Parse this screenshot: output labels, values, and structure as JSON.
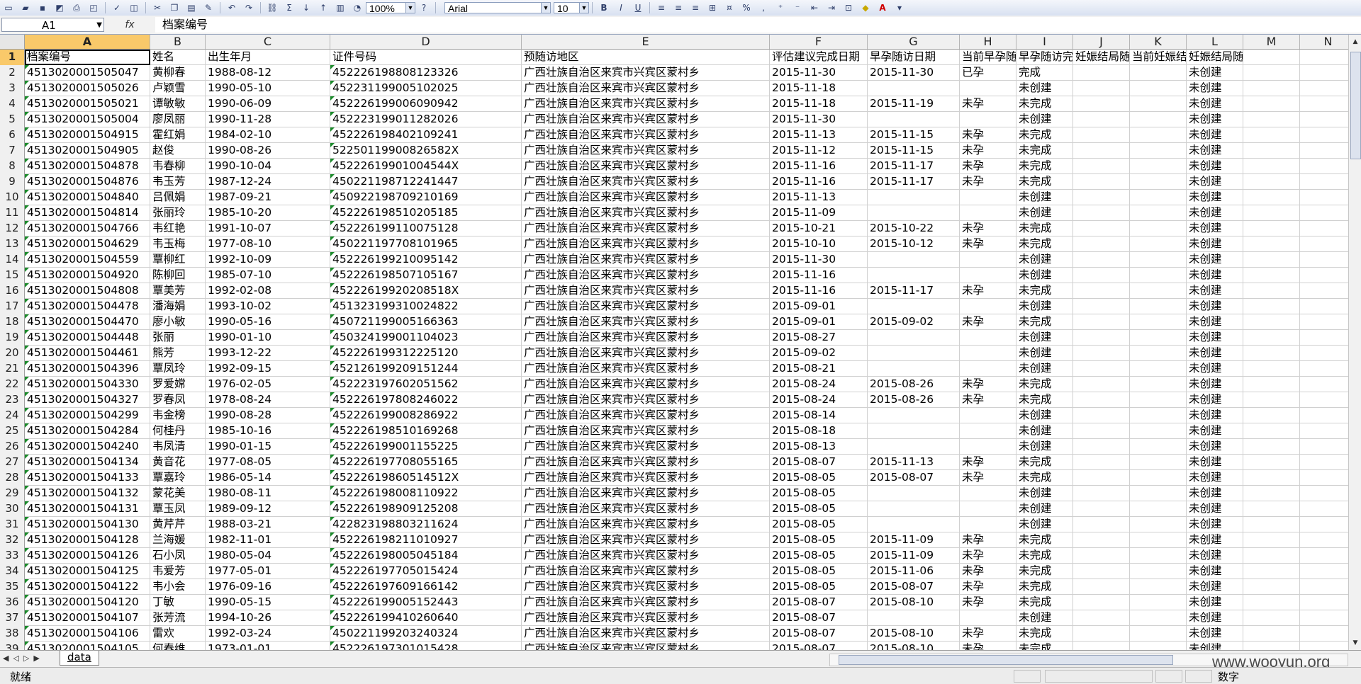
{
  "toolbar": {
    "zoom": "100%",
    "font_name": "Arial",
    "font_size": "10",
    "bold": "B",
    "italic": "I",
    "underline": "U",
    "percent": "%",
    "comma": ",",
    "sigma": "Σ"
  },
  "formula_bar": {
    "cell_ref": "A1",
    "fx": "fx",
    "content": "档案编号"
  },
  "columns": [
    "A",
    "B",
    "C",
    "D",
    "E",
    "F",
    "G",
    "H",
    "I",
    "J",
    "K",
    "L",
    "M",
    "N"
  ],
  "header_row": [
    "档案编号",
    "姓名",
    "出生年月",
    "证件号码",
    "预随访地区",
    "评估建议完成日期",
    "早孕随访日期",
    "当前早孕随访",
    "早孕随访完成",
    "妊娠结局随访日期",
    "当前妊娠结局",
    "妊娠结局随访完成状态",
    "",
    ""
  ],
  "rows": [
    {
      "n": "2",
      "cells": [
        "4513020001505047",
        "黄柳春",
        "1988-08-12",
        "452226198808123326",
        "广西壮族自治区来宾市兴宾区蒙村乡",
        "2015-11-30",
        "2015-11-30",
        "已孕",
        "完成",
        "",
        "",
        "未创建",
        "",
        ""
      ]
    },
    {
      "n": "3",
      "cells": [
        "4513020001505026",
        "卢颖雪",
        "1990-05-10",
        "452231199005102025",
        "广西壮族自治区来宾市兴宾区蒙村乡",
        "2015-11-18",
        "",
        "",
        "未创建",
        "",
        "",
        "未创建",
        "",
        ""
      ]
    },
    {
      "n": "4",
      "cells": [
        "4513020001505021",
        "谭敏敏",
        "1990-06-09",
        "452226199006090942",
        "广西壮族自治区来宾市兴宾区蒙村乡",
        "2015-11-18",
        "2015-11-19",
        "未孕",
        "未完成",
        "",
        "",
        "未创建",
        "",
        ""
      ]
    },
    {
      "n": "5",
      "cells": [
        "4513020001505004",
        "廖凤丽",
        "1990-11-28",
        "452223199011282026",
        "广西壮族自治区来宾市兴宾区蒙村乡",
        "2015-11-30",
        "",
        "",
        "未创建",
        "",
        "",
        "未创建",
        "",
        ""
      ]
    },
    {
      "n": "6",
      "cells": [
        "4513020001504915",
        "霍红娟",
        "1984-02-10",
        "452226198402109241",
        "广西壮族自治区来宾市兴宾区蒙村乡",
        "2015-11-13",
        "2015-11-15",
        "未孕",
        "未完成",
        "",
        "",
        "未创建",
        "",
        ""
      ]
    },
    {
      "n": "7",
      "cells": [
        "4513020001504905",
        "赵俊",
        "1990-08-26",
        "52250119900826582X",
        "广西壮族自治区来宾市兴宾区蒙村乡",
        "2015-11-12",
        "2015-11-15",
        "未孕",
        "未完成",
        "",
        "",
        "未创建",
        "",
        ""
      ]
    },
    {
      "n": "8",
      "cells": [
        "4513020001504878",
        "韦春柳",
        "1990-10-04",
        "45222619901004544X",
        "广西壮族自治区来宾市兴宾区蒙村乡",
        "2015-11-16",
        "2015-11-17",
        "未孕",
        "未完成",
        "",
        "",
        "未创建",
        "",
        ""
      ]
    },
    {
      "n": "9",
      "cells": [
        "4513020001504876",
        "韦玉芳",
        "1987-12-24",
        "450221198712241447",
        "广西壮族自治区来宾市兴宾区蒙村乡",
        "2015-11-16",
        "2015-11-17",
        "未孕",
        "未完成",
        "",
        "",
        "未创建",
        "",
        ""
      ]
    },
    {
      "n": "10",
      "cells": [
        "4513020001504840",
        "吕佩娟",
        "1987-09-21",
        "450922198709210169",
        "广西壮族自治区来宾市兴宾区蒙村乡",
        "2015-11-13",
        "",
        "",
        "未创建",
        "",
        "",
        "未创建",
        "",
        ""
      ]
    },
    {
      "n": "11",
      "cells": [
        "4513020001504814",
        "张丽玲",
        "1985-10-20",
        "452226198510205185",
        "广西壮族自治区来宾市兴宾区蒙村乡",
        "2015-11-09",
        "",
        "",
        "未创建",
        "",
        "",
        "未创建",
        "",
        ""
      ]
    },
    {
      "n": "12",
      "cells": [
        "4513020001504766",
        "韦红艳",
        "1991-10-07",
        "452226199110075128",
        "广西壮族自治区来宾市兴宾区蒙村乡",
        "2015-10-21",
        "2015-10-22",
        "未孕",
        "未完成",
        "",
        "",
        "未创建",
        "",
        ""
      ]
    },
    {
      "n": "13",
      "cells": [
        "4513020001504629",
        "韦玉梅",
        "1977-08-10",
        "450221197708101965",
        "广西壮族自治区来宾市兴宾区蒙村乡",
        "2015-10-10",
        "2015-10-12",
        "未孕",
        "未完成",
        "",
        "",
        "未创建",
        "",
        ""
      ]
    },
    {
      "n": "14",
      "cells": [
        "4513020001504559",
        "覃柳红",
        "1992-10-09",
        "452226199210095142",
        "广西壮族自治区来宾市兴宾区蒙村乡",
        "2015-11-30",
        "",
        "",
        "未创建",
        "",
        "",
        "未创建",
        "",
        ""
      ]
    },
    {
      "n": "15",
      "cells": [
        "4513020001504920",
        "陈柳回",
        "1985-07-10",
        "452226198507105167",
        "广西壮族自治区来宾市兴宾区蒙村乡",
        "2015-11-16",
        "",
        "",
        "未创建",
        "",
        "",
        "未创建",
        "",
        ""
      ]
    },
    {
      "n": "16",
      "cells": [
        "4513020001504808",
        "覃美芳",
        "1992-02-08",
        "45222619920208518X",
        "广西壮族自治区来宾市兴宾区蒙村乡",
        "2015-11-16",
        "2015-11-17",
        "未孕",
        "未完成",
        "",
        "",
        "未创建",
        "",
        ""
      ]
    },
    {
      "n": "17",
      "cells": [
        "4513020001504478",
        "潘海娟",
        "1993-10-02",
        "451323199310024822",
        "广西壮族自治区来宾市兴宾区蒙村乡",
        "2015-09-01",
        "",
        "",
        "未创建",
        "",
        "",
        "未创建",
        "",
        ""
      ]
    },
    {
      "n": "18",
      "cells": [
        "4513020001504470",
        "廖小敏",
        "1990-05-16",
        "450721199005166363",
        "广西壮族自治区来宾市兴宾区蒙村乡",
        "2015-09-01",
        "2015-09-02",
        "未孕",
        "未完成",
        "",
        "",
        "未创建",
        "",
        ""
      ]
    },
    {
      "n": "19",
      "cells": [
        "4513020001504448",
        "张丽",
        "1990-01-10",
        "450324199001104023",
        "广西壮族自治区来宾市兴宾区蒙村乡",
        "2015-08-27",
        "",
        "",
        "未创建",
        "",
        "",
        "未创建",
        "",
        ""
      ]
    },
    {
      "n": "20",
      "cells": [
        "4513020001504461",
        "熊芳",
        "1993-12-22",
        "452226199312225120",
        "广西壮族自治区来宾市兴宾区蒙村乡",
        "2015-09-02",
        "",
        "",
        "未创建",
        "",
        "",
        "未创建",
        "",
        ""
      ]
    },
    {
      "n": "21",
      "cells": [
        "4513020001504396",
        "覃凤玲",
        "1992-09-15",
        "452126199209151244",
        "广西壮族自治区来宾市兴宾区蒙村乡",
        "2015-08-21",
        "",
        "",
        "未创建",
        "",
        "",
        "未创建",
        "",
        ""
      ]
    },
    {
      "n": "22",
      "cells": [
        "4513020001504330",
        "罗爱嫦",
        "1976-02-05",
        "452223197602051562",
        "广西壮族自治区来宾市兴宾区蒙村乡",
        "2015-08-24",
        "2015-08-26",
        "未孕",
        "未完成",
        "",
        "",
        "未创建",
        "",
        ""
      ]
    },
    {
      "n": "23",
      "cells": [
        "4513020001504327",
        "罗春凤",
        "1978-08-24",
        "452226197808246022",
        "广西壮族自治区来宾市兴宾区蒙村乡",
        "2015-08-24",
        "2015-08-26",
        "未孕",
        "未完成",
        "",
        "",
        "未创建",
        "",
        ""
      ]
    },
    {
      "n": "24",
      "cells": [
        "4513020001504299",
        "韦金榜",
        "1990-08-28",
        "452226199008286922",
        "广西壮族自治区来宾市兴宾区蒙村乡",
        "2015-08-14",
        "",
        "",
        "未创建",
        "",
        "",
        "未创建",
        "",
        ""
      ]
    },
    {
      "n": "25",
      "cells": [
        "4513020001504284",
        "何桂丹",
        "1985-10-16",
        "452226198510169268",
        "广西壮族自治区来宾市兴宾区蒙村乡",
        "2015-08-18",
        "",
        "",
        "未创建",
        "",
        "",
        "未创建",
        "",
        ""
      ]
    },
    {
      "n": "26",
      "cells": [
        "4513020001504240",
        "韦凤清",
        "1990-01-15",
        "452226199001155225",
        "广西壮族自治区来宾市兴宾区蒙村乡",
        "2015-08-13",
        "",
        "",
        "未创建",
        "",
        "",
        "未创建",
        "",
        ""
      ]
    },
    {
      "n": "27",
      "cells": [
        "4513020001504134",
        "黄音花",
        "1977-08-05",
        "452226197708055165",
        "广西壮族自治区来宾市兴宾区蒙村乡",
        "2015-08-07",
        "2015-11-13",
        "未孕",
        "未完成",
        "",
        "",
        "未创建",
        "",
        ""
      ]
    },
    {
      "n": "28",
      "cells": [
        "4513020001504133",
        "覃嘉玲",
        "1986-05-14",
        "45222619860514512X",
        "广西壮族自治区来宾市兴宾区蒙村乡",
        "2015-08-05",
        "2015-08-07",
        "未孕",
        "未完成",
        "",
        "",
        "未创建",
        "",
        ""
      ]
    },
    {
      "n": "29",
      "cells": [
        "4513020001504132",
        "蒙花美",
        "1980-08-11",
        "452226198008110922",
        "广西壮族自治区来宾市兴宾区蒙村乡",
        "2015-08-05",
        "",
        "",
        "未创建",
        "",
        "",
        "未创建",
        "",
        ""
      ]
    },
    {
      "n": "30",
      "cells": [
        "4513020001504131",
        "覃玉凤",
        "1989-09-12",
        "452226198909125208",
        "广西壮族自治区来宾市兴宾区蒙村乡",
        "2015-08-05",
        "",
        "",
        "未创建",
        "",
        "",
        "未创建",
        "",
        ""
      ]
    },
    {
      "n": "31",
      "cells": [
        "4513020001504130",
        "黄芹芹",
        "1988-03-21",
        "422823198803211624",
        "广西壮族自治区来宾市兴宾区蒙村乡",
        "2015-08-05",
        "",
        "",
        "未创建",
        "",
        "",
        "未创建",
        "",
        ""
      ]
    },
    {
      "n": "32",
      "cells": [
        "4513020001504128",
        "兰海媛",
        "1982-11-01",
        "452226198211010927",
        "广西壮族自治区来宾市兴宾区蒙村乡",
        "2015-08-05",
        "2015-11-09",
        "未孕",
        "未完成",
        "",
        "",
        "未创建",
        "",
        ""
      ]
    },
    {
      "n": "33",
      "cells": [
        "4513020001504126",
        "石小凤",
        "1980-05-04",
        "452226198005045184",
        "广西壮族自治区来宾市兴宾区蒙村乡",
        "2015-08-05",
        "2015-11-09",
        "未孕",
        "未完成",
        "",
        "",
        "未创建",
        "",
        ""
      ]
    },
    {
      "n": "34",
      "cells": [
        "4513020001504125",
        "韦爱芳",
        "1977-05-01",
        "452226197705015424",
        "广西壮族自治区来宾市兴宾区蒙村乡",
        "2015-08-05",
        "2015-11-06",
        "未孕",
        "未完成",
        "",
        "",
        "未创建",
        "",
        ""
      ]
    },
    {
      "n": "35",
      "cells": [
        "4513020001504122",
        "韦小会",
        "1976-09-16",
        "452226197609166142",
        "广西壮族自治区来宾市兴宾区蒙村乡",
        "2015-08-05",
        "2015-08-07",
        "未孕",
        "未完成",
        "",
        "",
        "未创建",
        "",
        ""
      ]
    },
    {
      "n": "36",
      "cells": [
        "4513020001504120",
        "丁敏",
        "1990-05-15",
        "452226199005152443",
        "广西壮族自治区来宾市兴宾区蒙村乡",
        "2015-08-07",
        "2015-08-10",
        "未孕",
        "未完成",
        "",
        "",
        "未创建",
        "",
        ""
      ]
    },
    {
      "n": "37",
      "cells": [
        "4513020001504107",
        "张芳流",
        "1994-10-26",
        "452226199410260640",
        "广西壮族自治区来宾市兴宾区蒙村乡",
        "2015-08-07",
        "",
        "",
        "未创建",
        "",
        "",
        "未创建",
        "",
        ""
      ]
    },
    {
      "n": "38",
      "cells": [
        "4513020001504106",
        "雷欢",
        "1992-03-24",
        "450221199203240324",
        "广西壮族自治区来宾市兴宾区蒙村乡",
        "2015-08-07",
        "2015-08-10",
        "未孕",
        "未完成",
        "",
        "",
        "未创建",
        "",
        ""
      ]
    },
    {
      "n": "39",
      "cells": [
        "4513020001504105",
        "何春维",
        "1973-01-01",
        "452226197301015428",
        "广西壮族自治区来宾市兴宾区蒙村乡",
        "2015-08-07",
        "2015-08-10",
        "未孕",
        "未完成",
        "",
        "",
        "未创建",
        "",
        ""
      ]
    }
  ],
  "sheet_tab": "data",
  "status": {
    "left": "就绪",
    "mode": "数字"
  },
  "watermark": "www.wooyun.org"
}
